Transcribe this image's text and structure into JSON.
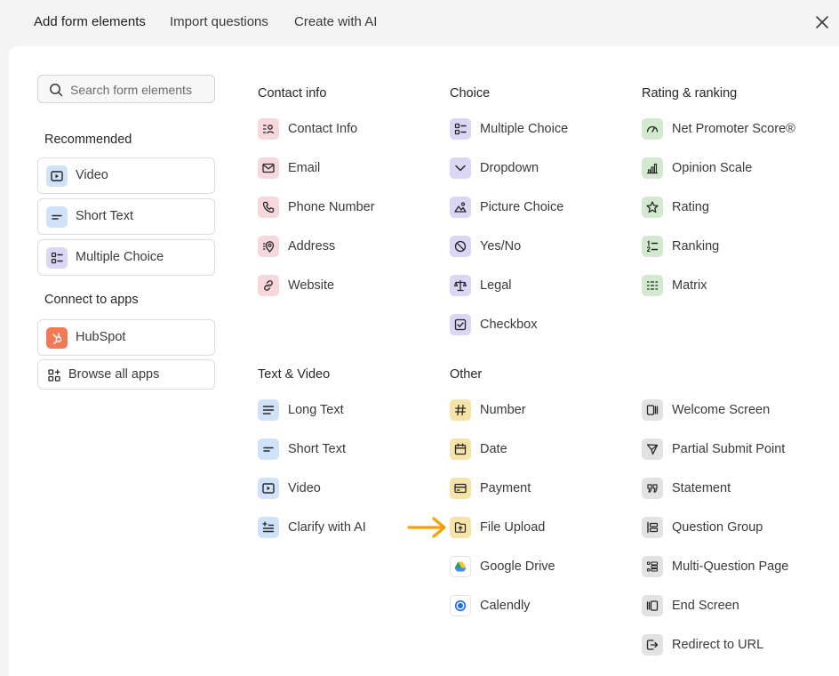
{
  "tabs": [
    "Add form elements",
    "Import questions",
    "Create with AI"
  ],
  "search": {
    "placeholder": "Search form elements"
  },
  "sidebar": {
    "recommended_title": "Recommended",
    "recommended": [
      {
        "label": "Video",
        "icon": "video-icon"
      },
      {
        "label": "Short Text",
        "icon": "short-text-icon"
      },
      {
        "label": "Multiple Choice",
        "icon": "multiple-choice-icon"
      }
    ],
    "apps_title": "Connect to apps",
    "apps": [
      {
        "label": "HubSpot",
        "icon": "hubspot-icon"
      },
      {
        "label": "Browse all apps",
        "icon": "apps-grid-icon"
      }
    ]
  },
  "contact": {
    "title": "Contact info",
    "items": [
      "Contact Info",
      "Email",
      "Phone Number",
      "Address",
      "Website"
    ]
  },
  "choice": {
    "title": "Choice",
    "items": [
      "Multiple Choice",
      "Dropdown",
      "Picture Choice",
      "Yes/No",
      "Legal",
      "Checkbox"
    ]
  },
  "rating": {
    "title": "Rating & ranking",
    "items": [
      "Net Promoter Score®",
      "Opinion Scale",
      "Rating",
      "Ranking",
      "Matrix"
    ]
  },
  "textvideo": {
    "title": "Text & Video",
    "items": [
      "Long Text",
      "Short Text",
      "Video",
      "Clarify with AI"
    ]
  },
  "other": {
    "title": "Other",
    "items": [
      "Number",
      "Date",
      "Payment",
      "File Upload",
      "Google Drive",
      "Calendly"
    ],
    "items2": [
      "Welcome Screen",
      "Partial Submit Point",
      "Statement",
      "Question Group",
      "Multi-Question Page",
      "End Screen",
      "Redirect to URL"
    ]
  },
  "colors": {
    "contact": "#f6d7db",
    "choice": "#dcd5f3",
    "rating": "#d2e9cf",
    "text": "#cfe2f7",
    "other": "#f5e3a8",
    "structure": "#e2e2e4",
    "arrow": "#f5a000"
  }
}
